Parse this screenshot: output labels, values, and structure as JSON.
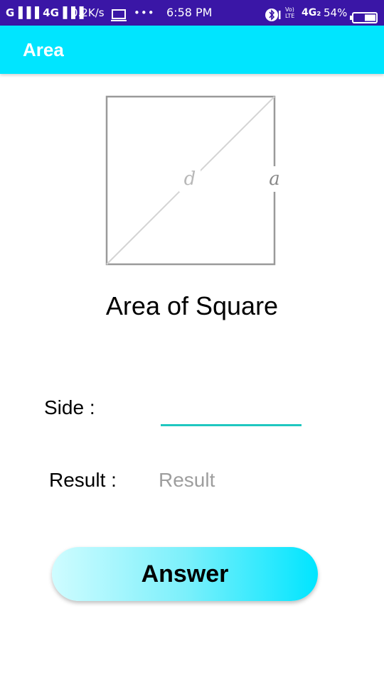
{
  "status_bar": {
    "signal_text": "G▐▐▐ 4G▐▐▐",
    "net_speed": "0.2K/s",
    "more": "•••",
    "time": "6:58 PM",
    "volte_line1": "Vo)",
    "volte_line2": "LTE",
    "network_4g": "4G₂",
    "battery_percent": "54%",
    "icons": [
      "signal-icon",
      "monitor-icon",
      "bluetooth-icon",
      "volte-icon",
      "battery-icon"
    ]
  },
  "app_bar": {
    "title": "Area",
    "color": "#00e5ff"
  },
  "figure": {
    "diagonal_label": "d",
    "side_label": "a"
  },
  "heading": "Area of Square",
  "form": {
    "side_label": "Side :",
    "side_value": "",
    "side_placeholder": "",
    "result_label": "Result :",
    "result_value": "Result",
    "underline_color": "#1fc7c0"
  },
  "answer_button": {
    "label": "Answer",
    "gradient": [
      "#cffcff",
      "#00e5ff"
    ]
  }
}
